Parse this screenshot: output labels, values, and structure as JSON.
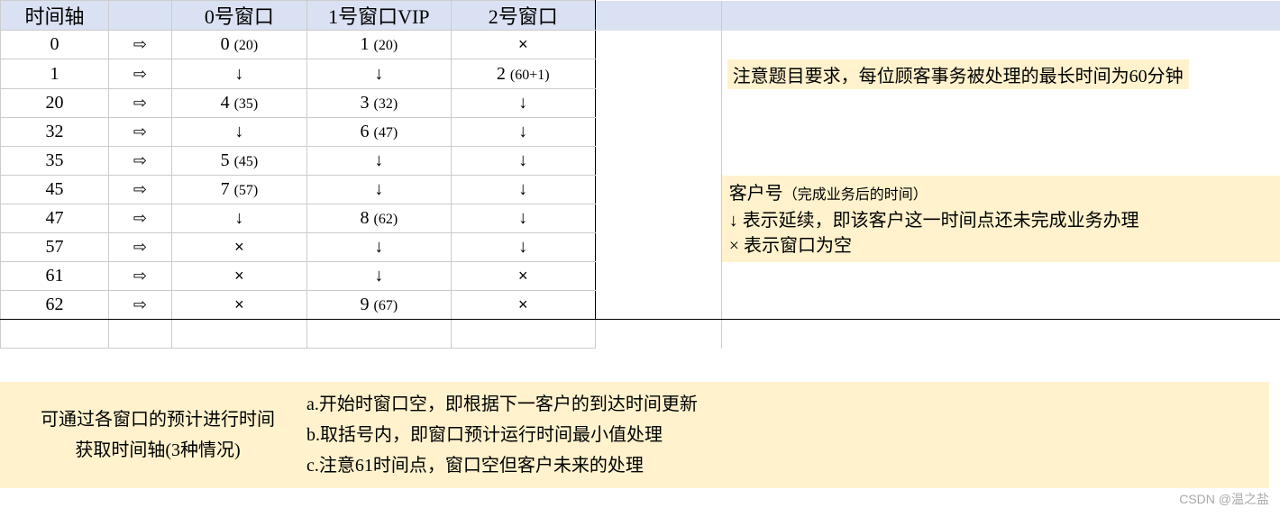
{
  "headers": {
    "time": "时间轴",
    "w0": "0号窗口",
    "w1": "1号窗口VIP",
    "w2": "2号窗口"
  },
  "arrow": "⇨",
  "rows": [
    {
      "t": "0",
      "w0": {
        "n": "0",
        "p": "(20)"
      },
      "w1": {
        "n": "1",
        "p": "(20)"
      },
      "w2": {
        "cross": true
      }
    },
    {
      "t": "1",
      "w0": {
        "down": true
      },
      "w1": {
        "down": true
      },
      "w2": {
        "n": "2",
        "p": "(60+1)"
      }
    },
    {
      "t": "20",
      "w0": {
        "n": "4",
        "p": "(35)"
      },
      "w1": {
        "n": "3",
        "p": "(32)"
      },
      "w2": {
        "down": true
      }
    },
    {
      "t": "32",
      "w0": {
        "down": true
      },
      "w1": {
        "n": "6",
        "p": "(47)"
      },
      "w2": {
        "down": true
      }
    },
    {
      "t": "35",
      "w0": {
        "n": "5",
        "p": "(45)"
      },
      "w1": {
        "down": true
      },
      "w2": {
        "down": true
      }
    },
    {
      "t": "45",
      "w0": {
        "n": "7",
        "p": "(57)"
      },
      "w1": {
        "down": true
      },
      "w2": {
        "down": true
      }
    },
    {
      "t": "47",
      "w0": {
        "down": true
      },
      "w1": {
        "n": "8",
        "p": "(62)"
      },
      "w2": {
        "down": true
      }
    },
    {
      "t": "57",
      "w0": {
        "cross": true
      },
      "w1": {
        "down": true
      },
      "w2": {
        "down": true
      }
    },
    {
      "t": "61",
      "w0": {
        "cross": true
      },
      "w1": {
        "down": true
      },
      "w2": {
        "cross": true
      }
    },
    {
      "t": "62",
      "w0": {
        "cross": true
      },
      "w1": {
        "n": "9",
        "p": "(67)"
      },
      "w2": {
        "cross": true
      }
    }
  ],
  "note1": "注意题目要求，每位顾客事务被处理的最长时间为60分钟",
  "legend": {
    "title": "客户号",
    "subtitle": "（完成业务后的时间）",
    "line1": "↓  表示延续，即该客户这一时间点还未完成业务办理",
    "line2": "×  表示窗口为空"
  },
  "bottom": {
    "left1": "可通过各窗口的预计进行时间",
    "left2": "获取时间轴(3种情况)",
    "a": "a.开始时窗口空，即根据下一客户的到达时间更新",
    "b": "b.取括号内，即窗口预计运行时间最小值处理",
    "c": "c.注意61时间点，窗口空但客户未来的处理"
  },
  "watermark": "CSDN @温之盐",
  "symbols": {
    "down": "↓",
    "cross": "×"
  }
}
